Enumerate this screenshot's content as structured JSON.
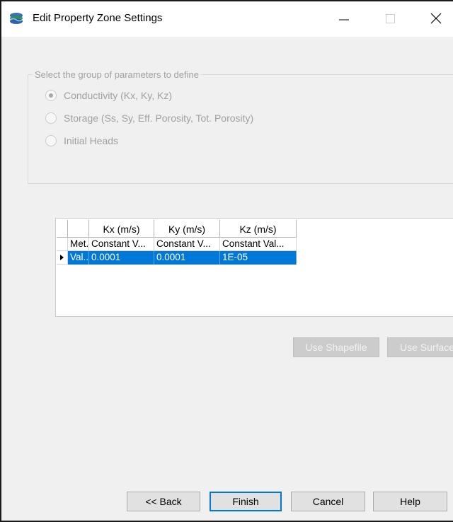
{
  "window": {
    "title": "Edit Property Zone Settings"
  },
  "icons": {
    "app": "layers-app-icon",
    "minimize": "minimize-icon",
    "maximize": "maximize-icon",
    "close": "close-icon",
    "row_indicator": "row-arrow-icon"
  },
  "group": {
    "legend": "Select the group of parameters to define",
    "options": [
      {
        "label": "Conductivity (Kx, Ky, Kz)",
        "selected": true
      },
      {
        "label": "Storage (Ss, Sy, Eff. Porosity, Tot. Porosity)",
        "selected": false
      },
      {
        "label": "Initial Heads",
        "selected": false
      }
    ]
  },
  "grid": {
    "columns": [
      "",
      "Kx (m/s)",
      "Ky (m/s)",
      "Kz (m/s)"
    ],
    "rows": [
      {
        "cells": [
          "Met...",
          "Constant V...",
          "Constant V...",
          "Constant Val..."
        ],
        "selected": false
      },
      {
        "cells": [
          "Val...",
          "0.0001",
          "0.0001",
          "1E-05"
        ],
        "selected": true
      }
    ]
  },
  "actions": {
    "use_shapefile": "Use Shapefile",
    "use_surface": "Use Surface"
  },
  "footer": {
    "back": "<< Back",
    "finish": "Finish",
    "cancel": "Cancel",
    "help": "Help"
  },
  "colors": {
    "selection": "#0078d7",
    "disabled_text": "#a0a0a0",
    "dialog_bg": "#f0f0f0"
  }
}
